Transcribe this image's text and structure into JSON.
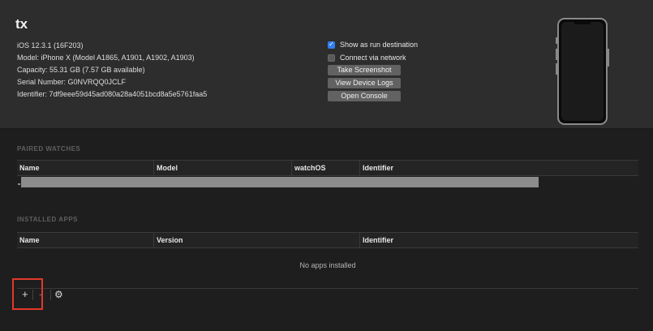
{
  "device": {
    "name": "tx",
    "info": [
      "iOS 12.3.1 (16F203)",
      "Model: iPhone X (Model A1865, A1901, A1902, A1903)",
      "Capacity: 55.31 GB (7.57 GB available)",
      "Serial Number: G0NVRQQ0JCLF",
      "Identifier: 7df9eee59d45ad080a28a4051bcd8a5e5761faa5"
    ]
  },
  "options": {
    "run_destination": {
      "label": "Show as run destination",
      "checked": true
    },
    "network": {
      "label": "Connect via network",
      "checked": false
    }
  },
  "buttons": {
    "screenshot": "Take Screenshot",
    "logs": "View Device Logs",
    "console": "Open Console"
  },
  "paired_watches": {
    "title": "PAIRED WATCHES",
    "columns": [
      "Name",
      "Model",
      "watchOS",
      "Identifier"
    ]
  },
  "installed_apps": {
    "title": "INSTALLED APPS",
    "columns": [
      "Name",
      "Version",
      "Identifier"
    ],
    "empty_text": "No apps installed"
  },
  "toolbar": {
    "add": "+",
    "remove": "-",
    "settings_glyph": "⚙"
  },
  "colors": {
    "accent": "#2f7ff0",
    "highlight": "#e2382b"
  }
}
